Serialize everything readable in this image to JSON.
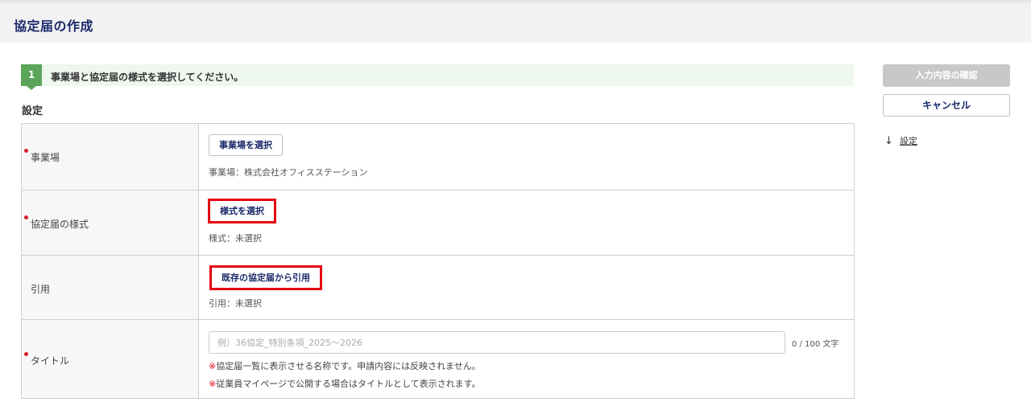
{
  "page": {
    "title": "協定届の作成"
  },
  "step": {
    "number": "1",
    "text": "事業場と協定届の様式を選択してください。"
  },
  "section": {
    "title": "設定"
  },
  "form": {
    "workplace": {
      "label": "事業場",
      "required": true,
      "button_label": "事業場を選択",
      "value_text": "事業場：株式会社オフィスステーション"
    },
    "template": {
      "label": "協定届の様式",
      "required": true,
      "button_label": "様式を選択",
      "value_text": "様式：未選択"
    },
    "quote": {
      "label": "引用",
      "required": false,
      "button_label": "既存の協定届から引用",
      "value_text": "引用：未選択"
    },
    "title_field": {
      "label": "タイトル",
      "required": true,
      "placeholder": "例）36協定_特別条項_2025～2026",
      "value": "",
      "char_count": "0 / 100 文字",
      "note_mark": "※",
      "note1": "協定届一覧に表示させる名称です。申請内容には反映されません。",
      "note2": "従業員マイページで公開する場合はタイトルとして表示されます。"
    }
  },
  "sidebar": {
    "confirm_label": "入力内容の確認",
    "cancel_label": "キャンセル",
    "anchor_arrow": "↓",
    "anchor_label": "設定"
  },
  "colors": {
    "title_navy": "#1b2a6b",
    "step_green": "#5aa55a",
    "step_bg": "#eef7ee",
    "required_red": "#d81e2c",
    "highlight_red": "#e60012",
    "disabled_gray": "#c8c8c8"
  }
}
